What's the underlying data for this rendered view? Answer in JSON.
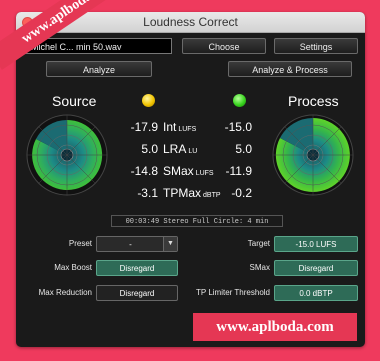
{
  "window": {
    "title": "Loudness Correct",
    "file_name": "Michel C... min 50.wav",
    "choose_label": "Choose",
    "settings_label": "Settings",
    "analyze_label": "Analyze",
    "analyze_process_label": "Analyze & Process"
  },
  "source": {
    "label": "Source",
    "led_color": "#f2c400",
    "int": "-17.9",
    "lra": "5.0",
    "smax": "-14.8",
    "tpmax": "-3.1"
  },
  "process": {
    "label": "Process",
    "led_color": "#39d51f",
    "int": "-15.0",
    "lra": "5.0",
    "smax": "-11.9",
    "tpmax": "-0.2"
  },
  "metrics": {
    "int_name": "Int",
    "int_unit": "LUFS",
    "lra_name": "LRA",
    "lra_unit": "LU",
    "smax_name": "SMax",
    "smax_unit": "LUFS",
    "tpmax_name": "TPMax",
    "tpmax_unit": "dBTP"
  },
  "status_text": "00:03:49 Stereo Full Circle: 4 min",
  "params": {
    "preset_label": "Preset",
    "preset_value": "-",
    "max_boost_label": "Max Boost",
    "max_boost_value": "Disregard",
    "max_reduction_label": "Max Reduction",
    "max_reduction_value": "Disregard",
    "target_label": "Target",
    "target_value": "-15.0 LUFS",
    "smax_label": "SMax",
    "smax_value": "Disregard",
    "tp_limiter_label": "TP Limiter Threshold",
    "tp_limiter_value": "0.0 dBTP"
  },
  "watermarks": {
    "banner_text": "www.aplboda.com",
    "bottom_text": "www.aplboda.com"
  },
  "colors": {
    "background": "#ef3a5d",
    "watermark": "#e53754",
    "meter_green": "#3fbf3a",
    "meter_teal": "#1d8a86",
    "button_green": "#2e6b57"
  }
}
